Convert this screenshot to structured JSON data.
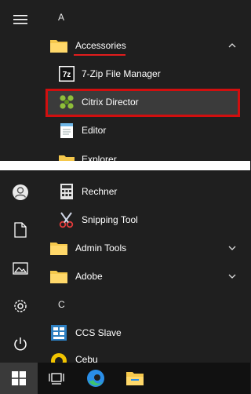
{
  "letters": {
    "a": "A",
    "c": "C"
  },
  "apps": {
    "accessories": "Accessories",
    "sevenzip": "7-Zip File Manager",
    "citrix_director": "Citrix Director",
    "editor": "Editor",
    "explorer": "Explorer",
    "rechner": "Rechner",
    "snipping_tool": "Snipping Tool",
    "admin_tools": "Admin Tools",
    "adobe": "Adobe",
    "ccs_slave": "CCS Slave",
    "cebu": "Cebu"
  },
  "icons": {
    "sevenzip_glyph": "7z"
  },
  "colors": {
    "highlight_border": "#d10f0f",
    "underline": "#e11d1d",
    "folder": "#f5c84c",
    "edge_blue": "#2a8ee8",
    "edge_green": "#3ec46d"
  }
}
